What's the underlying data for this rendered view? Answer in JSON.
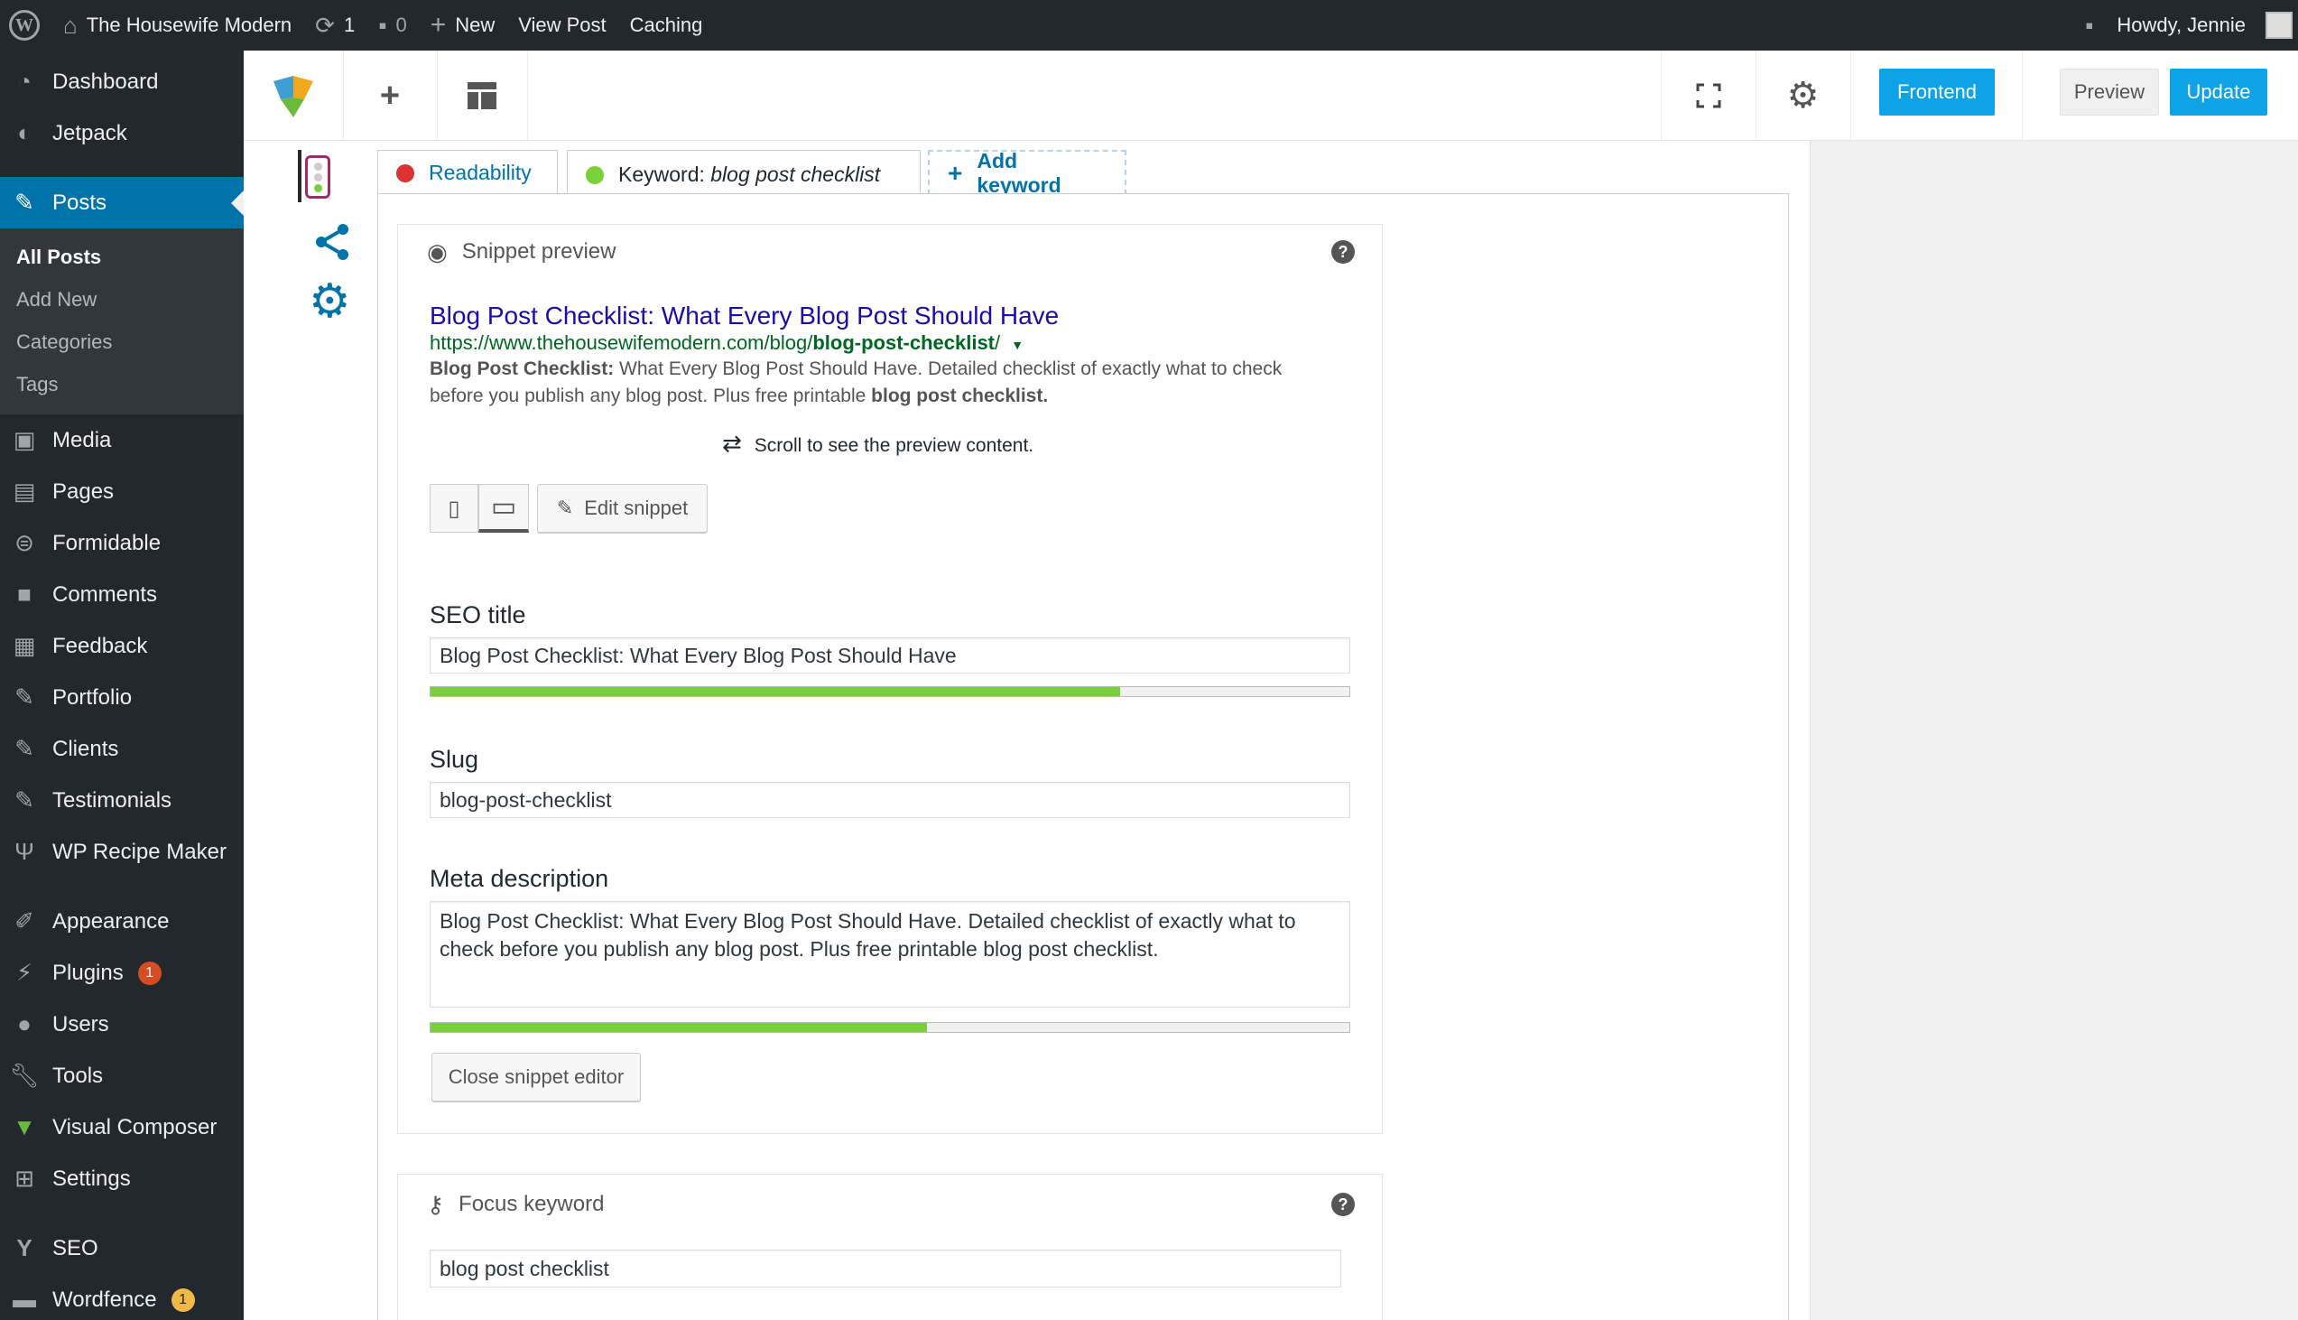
{
  "adminbar": {
    "site_name": "The Housewife Modern",
    "updates_count": "1",
    "comments_count": "0",
    "new_label": "New",
    "view_post": "View Post",
    "caching": "Caching",
    "howdy": "Howdy, Jennie"
  },
  "sidebar": {
    "items": [
      {
        "label": "Dashboard",
        "icon": "dashboard-icon"
      },
      {
        "label": "Jetpack",
        "icon": "jetpack-icon"
      },
      {
        "label": "Posts",
        "icon": "pin-icon"
      },
      {
        "label": "Media",
        "icon": "media-icon"
      },
      {
        "label": "Pages",
        "icon": "pages-icon"
      },
      {
        "label": "Formidable",
        "icon": "formidable-icon"
      },
      {
        "label": "Comments",
        "icon": "comment-icon"
      },
      {
        "label": "Feedback",
        "icon": "feedback-icon"
      },
      {
        "label": "Portfolio",
        "icon": "pin-icon"
      },
      {
        "label": "Clients",
        "icon": "pin-icon"
      },
      {
        "label": "Testimonials",
        "icon": "pin-icon"
      },
      {
        "label": "WP Recipe Maker",
        "icon": "utensils-icon"
      },
      {
        "label": "Appearance",
        "icon": "brush-icon"
      },
      {
        "label": "Plugins",
        "icon": "plug-icon",
        "badge": "1"
      },
      {
        "label": "Users",
        "icon": "user-icon"
      },
      {
        "label": "Tools",
        "icon": "wrench-icon"
      },
      {
        "label": "Visual Composer",
        "icon": "vc-icon"
      },
      {
        "label": "Settings",
        "icon": "settings-icon"
      },
      {
        "label": "SEO",
        "icon": "yoast-icon"
      },
      {
        "label": "Wordfence",
        "icon": "wordfence-icon",
        "badge": "1"
      }
    ],
    "posts_submenu": [
      "All Posts",
      "Add New",
      "Categories",
      "Tags"
    ]
  },
  "toolbar": {
    "frontend": "Frontend",
    "preview": "Preview",
    "update": "Update"
  },
  "tabs": {
    "readability": "Readability",
    "keyword_prefix": "Keyword: ",
    "keyword_value": "blog post checklist",
    "add_keyword": "Add keyword"
  },
  "snippet": {
    "header": "Snippet preview",
    "title": "Blog Post Checklist: What Every Blog Post Should Have",
    "url_base": "https://www.thehousewifemodern.com/blog/",
    "url_bold": "blog-post-checklist",
    "url_end": "/",
    "desc_bold1": "Blog Post Checklist:",
    "desc_part1": " What Every Blog Post Should Have. Detailed checklist of exactly what to check before you publish any blog post. Plus free printable ",
    "desc_bold2": "blog post checklist.",
    "scroll_hint": "Scroll to see the preview content.",
    "edit_snippet": "Edit snippet"
  },
  "editor": {
    "seo_title_label": "SEO title",
    "seo_title_value": "Blog Post Checklist: What Every Blog Post Should Have",
    "seo_title_progress": 0.75,
    "slug_label": "Slug",
    "slug_value": "blog-post-checklist",
    "meta_label": "Meta description",
    "meta_value": "Blog Post Checklist: What Every Blog Post Should Have. Detailed checklist of exactly what to check before you publish any blog post. Plus free printable blog post checklist.",
    "meta_progress": 0.54,
    "close_button": "Close snippet editor"
  },
  "focus": {
    "header": "Focus keyword",
    "value": "blog post checklist"
  },
  "colors": {
    "readability_dot": "#dc3232",
    "keyword_dot": "#7ad03a",
    "accent": "#0073aa",
    "progress": "#7ad03a"
  }
}
